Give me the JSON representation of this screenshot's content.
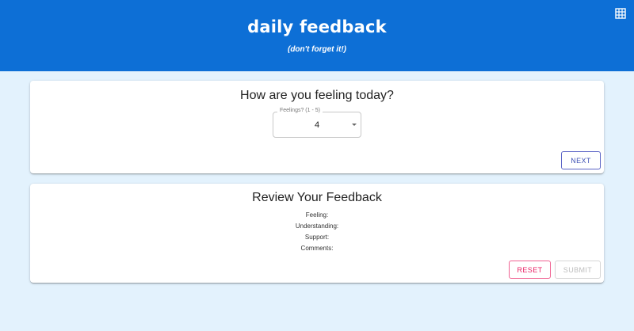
{
  "header": {
    "title": "daily feedback",
    "subtitle": "(don't forget it!)",
    "grid_icon": "grid-icon",
    "background": "#0d6fd6"
  },
  "page": {
    "background": "#e3f2fd"
  },
  "question_card": {
    "title": "How are you feeling today?",
    "select": {
      "label": "Feelings? (1 - 5)",
      "value": "4"
    },
    "next_button": "NEXT"
  },
  "review_card": {
    "title": "Review Your Feedback",
    "fields": {
      "feeling": "Feeling:",
      "understanding": "Understanding:",
      "support": "Support:",
      "comments": "Comments:"
    },
    "reset_button": "RESET",
    "submit_button": "SUBMIT"
  },
  "colors": {
    "next": "#3f51b5",
    "reset": "#e91e63",
    "disabled": "#bdbdbd"
  }
}
